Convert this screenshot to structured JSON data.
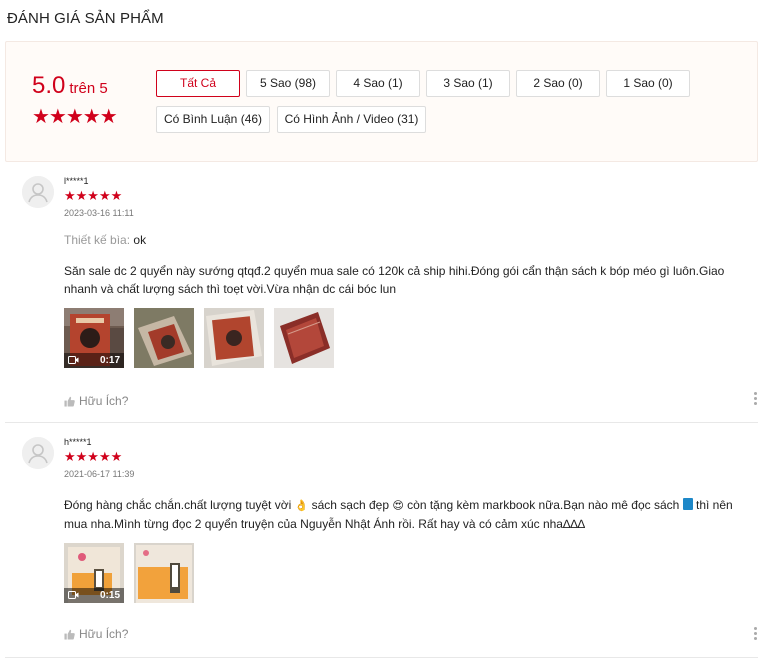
{
  "section_title": "ĐÁNH GIÁ SẢN PHẨM",
  "summary": {
    "score": "5.0",
    "score_suffix": "trên 5",
    "star_rating": 5,
    "stars_text": "★★★★★",
    "filters": [
      {
        "label": "Tất Cả",
        "active": true
      },
      {
        "label": "5 Sao (98)"
      },
      {
        "label": "4 Sao (1)"
      },
      {
        "label": "3 Sao (1)"
      },
      {
        "label": "2 Sao (0)"
      },
      {
        "label": "1 Sao (0)"
      },
      {
        "label": "Có Bình Luận (46)"
      },
      {
        "label": "Có Hình Ảnh / Video (31)"
      }
    ]
  },
  "reviews": [
    {
      "username": "l*****1",
      "stars": 5,
      "stars_text": "★★★★★",
      "date": "2023-03-16 11:11",
      "design_label": "Thiết kế bìa:",
      "design_value": "ok",
      "text": "Săn sale dc 2 quyển này sướng qtqđ.2 quyển mua sale có 120k cả ship hihi.Đóng gói cẩn thận sách k bóp méo gì luôn.Giao nhanh và chất lượng sách thì toẹt vời.Vừa nhận dc cái bóc lun",
      "video_duration": "0:17",
      "helpful_label": "Hữu Ích?"
    },
    {
      "username": "h*****1",
      "stars": 5,
      "stars_text": "★★★★★",
      "date": "2021-06-17 11:39",
      "text_part1": "Đóng hàng chắc chắn.chất lượng tuyệt vời ",
      "text_part2": " sách  sạch đẹp ",
      "text_part3": " còn tặng kèm markbook nữa.Bạn nào mê đọc sách ",
      "text_part4": " thì nên mua nha.Mình từng đọc 2 quyển truyện của Nguyễn Nhật Ánh rồi. Rất hay và có  cảm xúc nha∆∆∆",
      "emoji_1": "👌",
      "emoji_2": "😍",
      "video_duration": "0:15",
      "helpful_label": "Hữu Ích?"
    }
  ],
  "colors": {
    "accent": "#d0011b",
    "summary_bg": "#fffbf8"
  },
  "icons": {
    "avatar": "user-silhouette-icon",
    "thumb": "thumbs-up-icon",
    "more": "kebab-menu-icon",
    "video": "video-camera-icon"
  }
}
